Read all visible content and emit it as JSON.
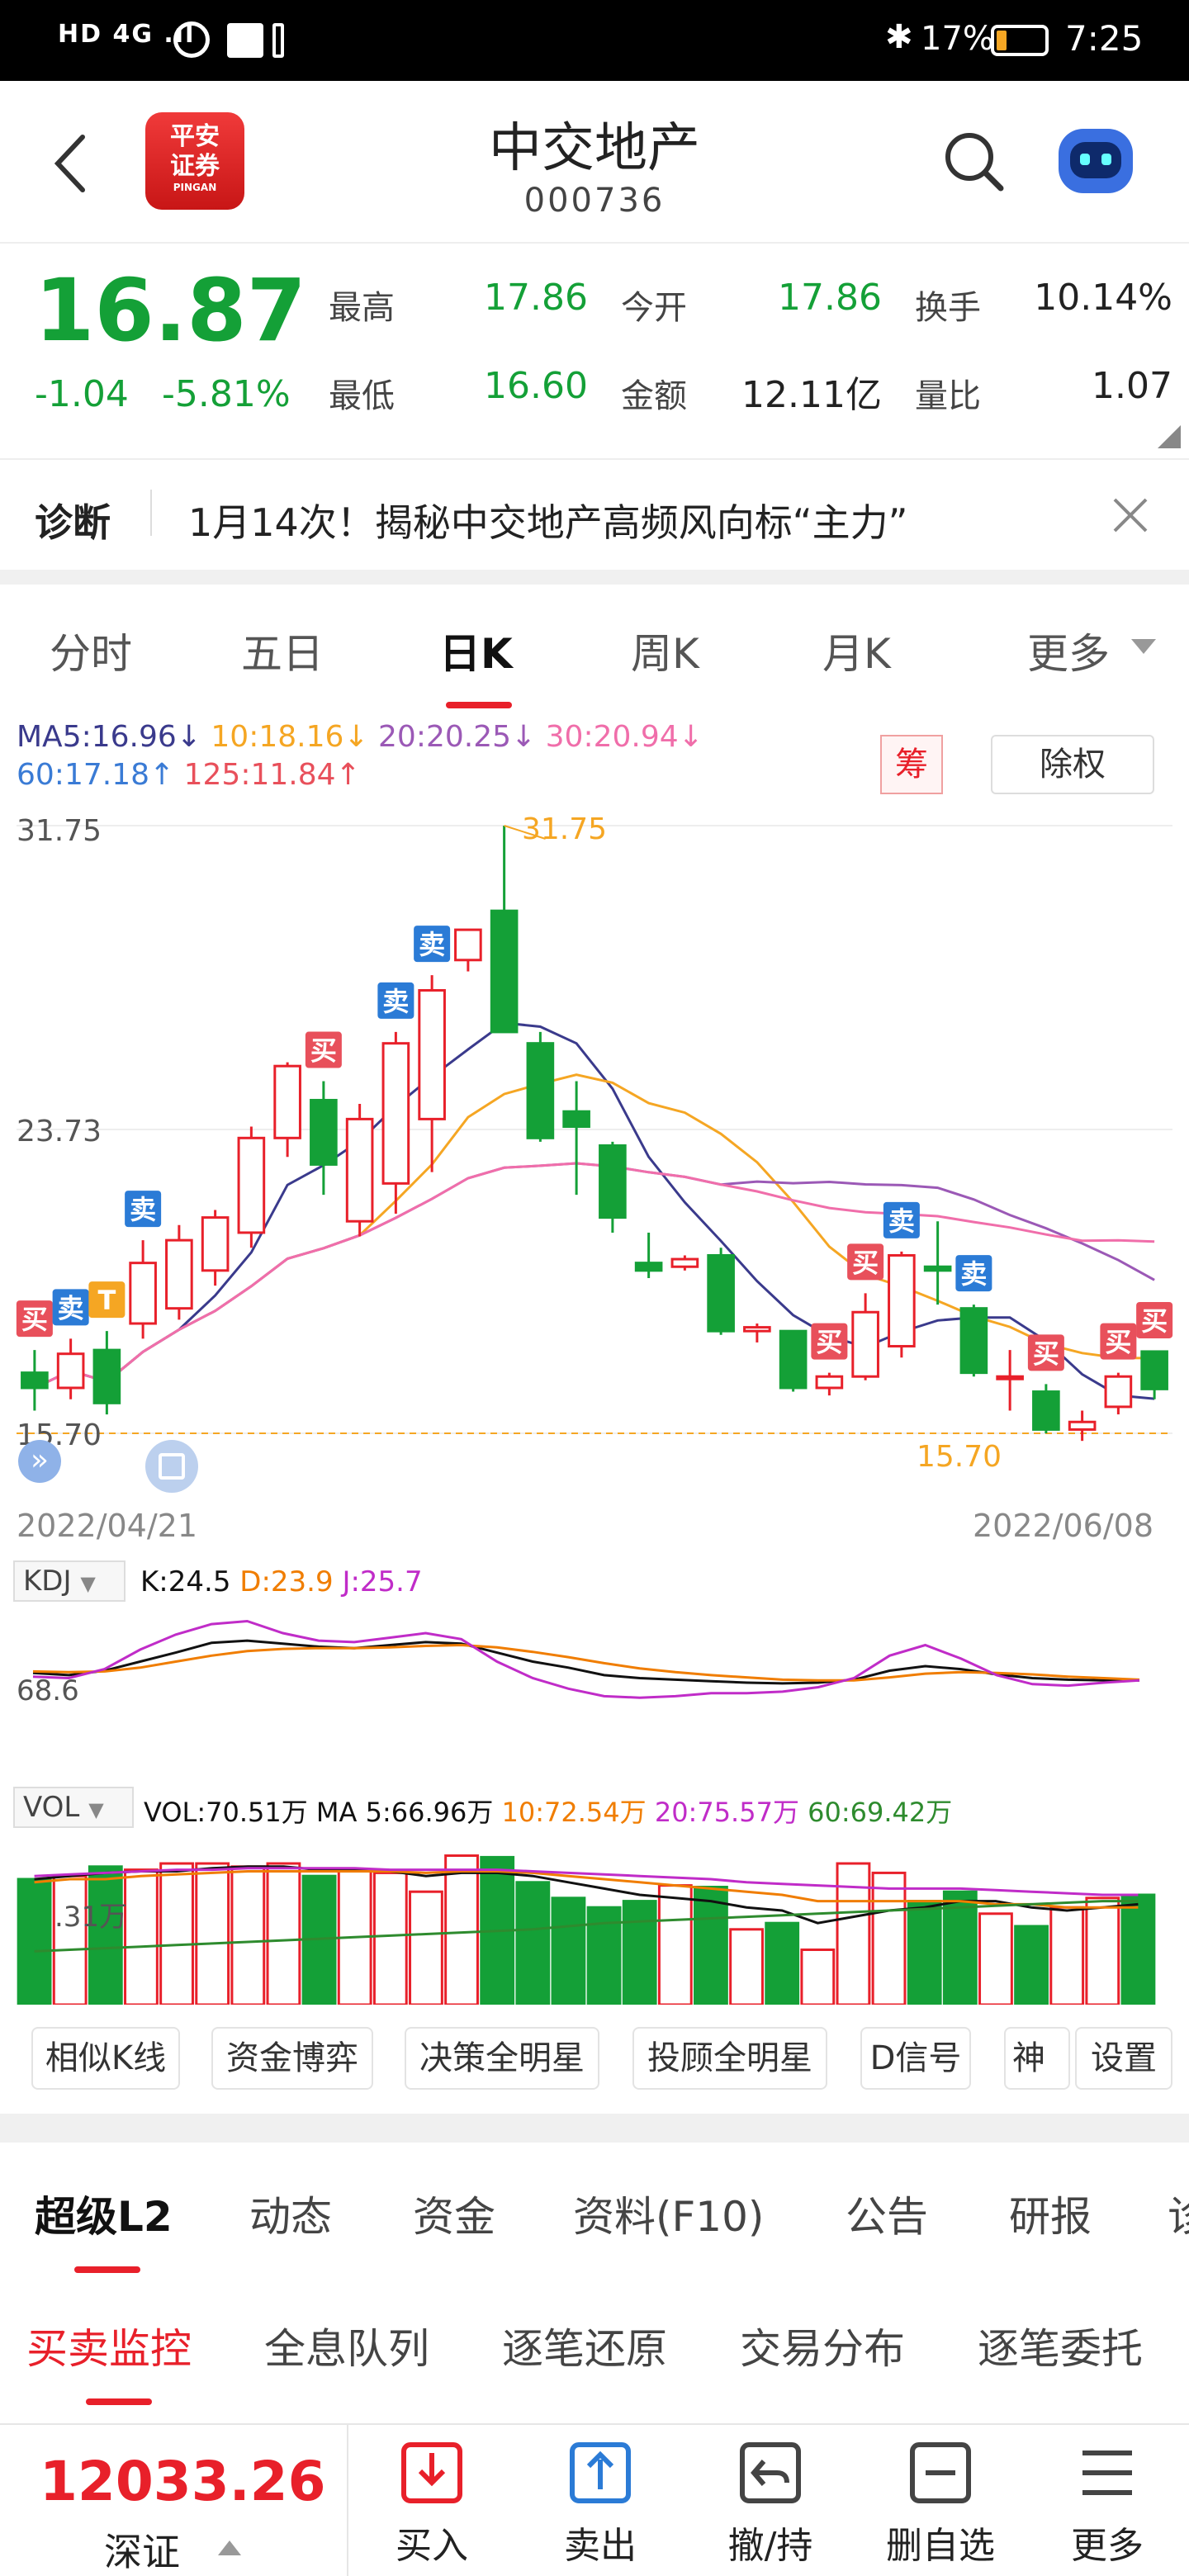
{
  "status_bar": {
    "left": "HD 4G .ıl",
    "battery": "17%",
    "time": "7:25"
  },
  "header": {
    "back_icon": "chevron-left-icon",
    "broker_logo": "平安\n证券",
    "broker_logo_sub": "PINGAN",
    "stock_name": "中交地产",
    "stock_code": "000736",
    "search_icon": "search-icon",
    "robot_icon": "robot-assistant-icon"
  },
  "quote": {
    "price": "16.87",
    "change": "-1.04",
    "change_pct": "-5.81%",
    "high_label": "最高",
    "high_value": "17.86",
    "low_label": "最低",
    "low_value": "16.60",
    "open_label": "今开",
    "open_value": "17.86",
    "amount_label": "金额",
    "amount_value": "12.11亿",
    "turnover_label": "换手",
    "turnover_value": "10.14%",
    "volume_ratio_label": "量比",
    "volume_ratio_value": "1.07"
  },
  "diagnosis": {
    "label": "诊断",
    "text": "1月14次！揭秘中交地产高频风向标“主力”"
  },
  "period_tabs": [
    "分时",
    "五日",
    "日K",
    "周K",
    "月K",
    "更多"
  ],
  "kline": {
    "ma_row1": [
      {
        "text": "MA5:16.96↓",
        "color": "#3a3a8c"
      },
      {
        "text": "10:18.16↓",
        "color": "#f5a623"
      },
      {
        "text": "20:20.25↓",
        "color": "#9b59b6"
      },
      {
        "text": "30:20.94↓",
        "color": "#f06eaa"
      }
    ],
    "ma_row2": [
      {
        "text": "60:17.18↑",
        "color": "#3a7bd5"
      },
      {
        "text": "125:11.84↑",
        "color": "#e8505b"
      }
    ],
    "chip_button": "筹",
    "adjust_button": "除权",
    "y_top": "31.75",
    "y_mid": "23.73",
    "y_bottom": "15.70",
    "max_annotation": "31.75",
    "min_annotation": "15.70",
    "date_start": "2022/04/21",
    "date_end": "2022/06/08"
  },
  "chart_data": {
    "type": "candlestick",
    "ylim": [
      15.7,
      31.75
    ],
    "candles": [
      {
        "o": 17.3,
        "c": 16.9,
        "h": 17.9,
        "l": 16.3
      },
      {
        "o": 16.9,
        "c": 17.8,
        "h": 18.2,
        "l": 16.6
      },
      {
        "o": 17.9,
        "c": 16.5,
        "h": 18.4,
        "l": 16.2
      },
      {
        "o": 18.6,
        "c": 20.2,
        "h": 20.8,
        "l": 18.2
      },
      {
        "o": 19.0,
        "c": 20.8,
        "h": 21.2,
        "l": 18.7
      },
      {
        "o": 20.0,
        "c": 21.4,
        "h": 21.6,
        "l": 19.6
      },
      {
        "o": 21.0,
        "c": 23.5,
        "h": 23.8,
        "l": 20.6
      },
      {
        "o": 23.5,
        "c": 25.4,
        "h": 25.5,
        "l": 23.0
      },
      {
        "o": 24.5,
        "c": 22.8,
        "h": 25.0,
        "l": 22.0
      },
      {
        "o": 21.3,
        "c": 24.0,
        "h": 24.4,
        "l": 20.9
      },
      {
        "o": 22.3,
        "c": 26.0,
        "h": 26.3,
        "l": 21.5
      },
      {
        "o": 24.0,
        "c": 27.4,
        "h": 27.8,
        "l": 22.6
      },
      {
        "o": 28.2,
        "c": 29.0,
        "h": 29.0,
        "l": 27.9
      },
      {
        "o": 29.5,
        "c": 26.3,
        "h": 31.75,
        "l": 26.3
      },
      {
        "o": 26.0,
        "c": 23.5,
        "h": 26.3,
        "l": 23.4
      },
      {
        "o": 24.2,
        "c": 23.8,
        "h": 25.0,
        "l": 22.0
      },
      {
        "o": 23.3,
        "c": 21.4,
        "h": 23.4,
        "l": 21.0
      },
      {
        "o": 20.2,
        "c": 20.0,
        "h": 21.0,
        "l": 19.8
      },
      {
        "o": 20.1,
        "c": 20.3,
        "h": 20.4,
        "l": 20.0
      },
      {
        "o": 20.4,
        "c": 18.4,
        "h": 20.6,
        "l": 18.3
      },
      {
        "o": 18.4,
        "c": 18.5,
        "h": 18.6,
        "l": 18.1
      },
      {
        "o": 18.4,
        "c": 16.9,
        "h": 18.4,
        "l": 16.8
      },
      {
        "o": 16.9,
        "c": 17.2,
        "h": 17.3,
        "l": 16.7
      },
      {
        "o": 17.2,
        "c": 18.9,
        "h": 19.4,
        "l": 17.1
      },
      {
        "o": 18.0,
        "c": 20.4,
        "h": 20.5,
        "l": 17.7
      },
      {
        "o": 20.1,
        "c": 20.0,
        "h": 21.3,
        "l": 19.1
      },
      {
        "o": 19.0,
        "c": 17.3,
        "h": 19.1,
        "l": 17.2
      },
      {
        "o": 17.2,
        "c": 17.2,
        "h": 17.9,
        "l": 16.3
      },
      {
        "o": 16.8,
        "c": 15.8,
        "h": 17.0,
        "l": 15.7
      },
      {
        "o": 15.8,
        "c": 16.0,
        "h": 16.3,
        "l": 15.5
      },
      {
        "o": 16.4,
        "c": 17.2,
        "h": 17.3,
        "l": 16.2
      },
      {
        "o": 17.86,
        "c": 16.87,
        "h": 17.86,
        "l": 16.6
      }
    ],
    "signals": [
      "买",
      "卖",
      "T",
      "卖",
      "卖",
      "买",
      "卖",
      "买",
      "买",
      "卖",
      "卖",
      "买",
      "买",
      "买"
    ]
  },
  "kdj": {
    "selector": "KDJ",
    "k": "K:24.5",
    "d": "D:23.9",
    "j": "J:25.7",
    "level": "68.6"
  },
  "vol": {
    "selector": "VOL",
    "vol": "VOL:70.51万",
    "ma5": "MA 5:66.96万",
    "ma10": "10:72.54万",
    "ma20": "20:75.57万",
    "ma60": "60:69.42万",
    "level": ".31万"
  },
  "tool_buttons": [
    "相似K线",
    "资金博弈",
    "决策全明星",
    "投顾全明星",
    "D信号",
    "神奇",
    "设置"
  ],
  "info_tabs": [
    "超级L2",
    "动态",
    "资金",
    "资料(F10)",
    "公告",
    "研报",
    "诊"
  ],
  "l2_tabs": [
    "买卖监控",
    "全息队列",
    "逐笔还原",
    "交易分布",
    "逐笔委托"
  ],
  "bottom": {
    "index_value": "12033.26",
    "index_name": "深证",
    "actions": [
      {
        "label": "买入",
        "icon": "buy-icon"
      },
      {
        "label": "卖出",
        "icon": "sell-icon"
      },
      {
        "label": "撤/持",
        "icon": "cancel-hold-icon"
      },
      {
        "label": "删自选",
        "icon": "remove-watchlist-icon"
      },
      {
        "label": "更多",
        "icon": "menu-icon"
      }
    ]
  },
  "colors": {
    "down_green": "#14a037",
    "up_red": "#e8202a",
    "accent_red": "#e8202a",
    "signal_blue": "#2b7bd6"
  }
}
